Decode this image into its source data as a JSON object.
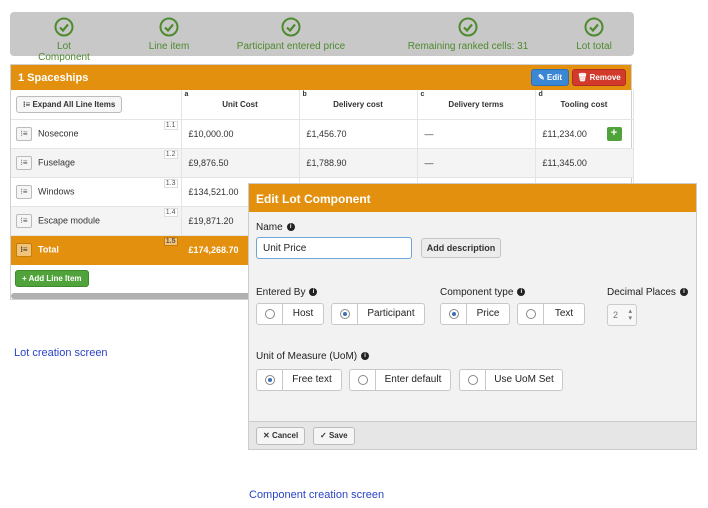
{
  "progress": {
    "steps": [
      {
        "label": "Lot Component",
        "icon": "check-circle-icon"
      },
      {
        "label": "Line item",
        "icon": "check-circle-icon"
      },
      {
        "label": "Participant entered price",
        "icon": "check-circle-icon"
      },
      {
        "label": "Remaining ranked cells: 31",
        "icon": "check-circle-icon"
      },
      {
        "label": "Lot total",
        "icon": "check-circle-icon"
      }
    ],
    "color": "#4e8a2e"
  },
  "lot": {
    "title": "1 Spaceships",
    "edit_label": "Edit",
    "remove_label": "Remove",
    "expand_label": "Expand All Line Items",
    "columns": [
      {
        "letter": "a",
        "label": "Unit Cost"
      },
      {
        "letter": "b",
        "label": "Delivery cost"
      },
      {
        "letter": "c",
        "label": "Delivery terms"
      },
      {
        "letter": "d",
        "label": "Tooling cost"
      }
    ],
    "rows": [
      {
        "num": "1.1",
        "name": "Nosecone",
        "unit": "£10,000.00",
        "delivery": "£1,456.70",
        "terms": "—",
        "tooling": "£11,234.00"
      },
      {
        "num": "1.2",
        "name": "Fuselage",
        "unit": "£9,876.50",
        "delivery": "£1,788.90",
        "terms": "—",
        "tooling": "£11,345.00"
      },
      {
        "num": "1.3",
        "name": "Windows",
        "unit": "£134,521.00",
        "delivery": "",
        "terms": "",
        "tooling": ""
      },
      {
        "num": "1.4",
        "name": "Escape module",
        "unit": "£19,871.20",
        "delivery": "",
        "terms": "",
        "tooling": ""
      }
    ],
    "total": {
      "num": "1.5",
      "name": "Total",
      "unit": "£174,268.70"
    },
    "add_line_label": "Add Line Item",
    "accent": "#e3900e"
  },
  "captions": {
    "lot": "Lot creation screen",
    "component": "Component creation screen"
  },
  "modal": {
    "title": "Edit Lot Component",
    "name_label": "Name",
    "name_value": "Unit Price",
    "add_description_label": "Add description",
    "entered_by_label": "Entered By",
    "entered_by_options": [
      {
        "label": "Host",
        "selected": false
      },
      {
        "label": "Participant",
        "selected": true
      }
    ],
    "component_type_label": "Component type",
    "component_type_options": [
      {
        "label": "Price",
        "selected": true
      },
      {
        "label": "Text",
        "selected": false
      }
    ],
    "decimal_places_label": "Decimal Places",
    "decimal_places_value": "2",
    "uom_label": "Unit of Measure (UoM)",
    "uom_options": [
      {
        "label": "Free text",
        "selected": true
      },
      {
        "label": "Enter default",
        "selected": false
      },
      {
        "label": "Use UoM Set",
        "selected": false
      }
    ],
    "cancel_label": "Cancel",
    "save_label": "Save"
  }
}
